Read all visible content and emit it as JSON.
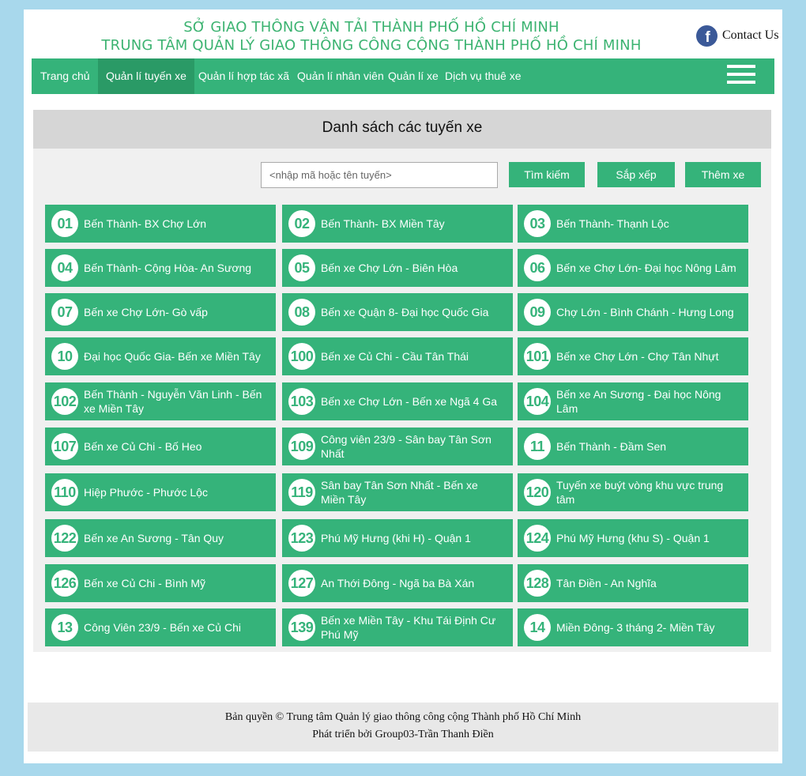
{
  "header": {
    "title_line1": "SỞ GIAO THÔNG VẬN TẢI THÀNH PHỐ HỒ CHÍ MINH",
    "title_line2": "TRUNG TÂM QUẢN LÝ GIAO THÔNG CÔNG CỘNG THÀNH PHỐ HỒ CHÍ MINH",
    "contact_label": "Contact Us",
    "facebook_icon": "facebook-icon"
  },
  "nav": {
    "items": [
      {
        "label": "Trang chủ"
      },
      {
        "label": "Quản lí tuyến xe",
        "active": true
      },
      {
        "label": "Quản lí hợp tác xã"
      },
      {
        "label": "Quản lí nhân viên"
      },
      {
        "label": "Quản lí xe"
      },
      {
        "label": "Dịch vụ thuê xe"
      }
    ],
    "menu_icon": "hamburger-menu-icon"
  },
  "main": {
    "title": "Danh sách các tuyến xe",
    "search_placeholder": "<nhập mã hoặc tên tuyến>",
    "search_button": "Tìm kiếm",
    "sort_button": "Sắp xếp",
    "add_button": "Thêm xe"
  },
  "routes": [
    {
      "code": "01",
      "name": "Bến Thành- BX Chợ Lớn"
    },
    {
      "code": "02",
      "name": "Bến Thành- BX Miền Tây"
    },
    {
      "code": "03",
      "name": "Bến Thành- Thạnh Lộc"
    },
    {
      "code": "04",
      "name": "Bến Thành- Cộng Hòa- An Sương"
    },
    {
      "code": "05",
      "name": "Bến xe Chợ Lớn - Biên Hòa"
    },
    {
      "code": "06",
      "name": "Bến xe Chợ Lớn- Đại học Nông Lâm"
    },
    {
      "code": "07",
      "name": "Bến xe Chợ Lớn- Gò vấp"
    },
    {
      "code": "08",
      "name": "Bến xe Quận 8- Đại học Quốc Gia"
    },
    {
      "code": "09",
      "name": "Chợ Lớn - Bình Chánh - Hưng Long"
    },
    {
      "code": "10",
      "name": "Đại học Quốc Gia- Bến xe Miền Tây"
    },
    {
      "code": "100",
      "name": "Bến xe Củ Chi - Cầu Tân Thái"
    },
    {
      "code": "101",
      "name": "Bến xe Chợ Lớn - Chợ Tân Nhựt"
    },
    {
      "code": "102",
      "name": "Bến Thành - Nguyễn Văn Linh - Bến xe Miền Tây"
    },
    {
      "code": "103",
      "name": "Bến xe Chợ Lớn - Bến xe Ngã 4 Ga"
    },
    {
      "code": "104",
      "name": "Bến xe An Sương - Đại học Nông Lâm"
    },
    {
      "code": "107",
      "name": "Bến xe Củ Chi - Bố Heo"
    },
    {
      "code": "109",
      "name": "Công viên 23/9 - Sân bay Tân Sơn Nhất"
    },
    {
      "code": "11",
      "name": "Bến Thành - Đầm Sen"
    },
    {
      "code": "110",
      "name": "Hiệp Phước - Phước Lộc"
    },
    {
      "code": "119",
      "name": "Sân bay Tân Sơn Nhất - Bến xe Miền Tây"
    },
    {
      "code": "120",
      "name": "Tuyến xe buýt vòng khu vực trung tâm"
    },
    {
      "code": "122",
      "name": "Bến xe An Sương - Tân Quy"
    },
    {
      "code": "123",
      "name": "Phú Mỹ Hưng (khi H) - Quận 1"
    },
    {
      "code": "124",
      "name": "Phú Mỹ Hưng (khu S) - Quận 1"
    },
    {
      "code": "126",
      "name": "Bến xe Củ Chi - Bình Mỹ"
    },
    {
      "code": "127",
      "name": "An Thới Đông - Ngã ba Bà Xán"
    },
    {
      "code": "128",
      "name": "Tân Điền - An Nghĩa"
    },
    {
      "code": "13",
      "name": "Công Viên 23/9 - Bến xe Củ Chi"
    },
    {
      "code": "139",
      "name": "Bến xe Miền Tây - Khu Tái Định Cư Phú Mỹ"
    },
    {
      "code": "14",
      "name": "Miền Đông- 3 tháng 2- Miền Tây"
    }
  ],
  "footer": {
    "copyright": "Bản quyền © Trung tâm Quản lý giao thông công cộng Thành phố Hồ Chí Minh",
    "developer": "Phát triển bởi Group03-Trần Thanh Điền"
  },
  "colors": {
    "accent": "#35b37a",
    "nav_active": "#2a9a66",
    "background": "#a8d8ec"
  }
}
